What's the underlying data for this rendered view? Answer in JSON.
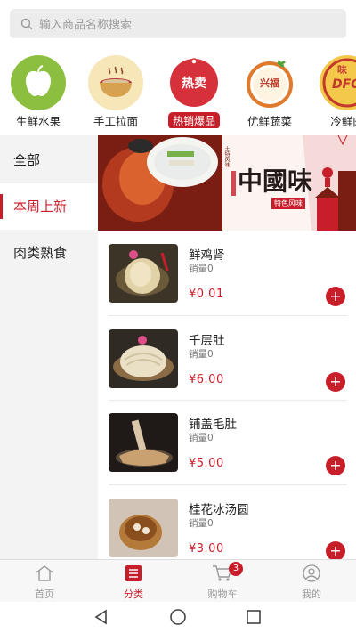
{
  "search": {
    "placeholder": "输入商品名称搜索"
  },
  "categories": [
    {
      "label": "生鲜水果",
      "icon": "apple-icon"
    },
    {
      "label": "手工拉面",
      "icon": "noodle-bowl-icon"
    },
    {
      "label": "热销爆品",
      "icon": "hot-sale-icon",
      "badge_text": "热卖"
    },
    {
      "label": "优鲜蔬菜",
      "icon": "vegetable-logo-icon",
      "logo_text": "兴福"
    },
    {
      "label": "冷鲜肉",
      "icon": "dfc-logo-icon",
      "logo_text": "DFC",
      "logo_small": "味"
    }
  ],
  "sidebar": {
    "items": [
      {
        "label": "全部"
      },
      {
        "label": "本周上新"
      },
      {
        "label": "肉类熟食"
      }
    ]
  },
  "banner": {
    "title": "中國味",
    "subtitle": "特色风味",
    "seal": "土特风味"
  },
  "products": [
    {
      "name": "鲜鸡肾",
      "sales": "销量0",
      "price": "¥0.01"
    },
    {
      "name": "千层肚",
      "sales": "销量0",
      "price": "¥6.00"
    },
    {
      "name": "铺盖毛肚",
      "sales": "销量0",
      "price": "¥5.00"
    },
    {
      "name": "桂花冰汤圆",
      "sales": "销量0",
      "price": "¥3.00"
    }
  ],
  "tabbar": {
    "items": [
      {
        "label": "首页",
        "icon": "home-icon"
      },
      {
        "label": "分类",
        "icon": "category-icon"
      },
      {
        "label": "购物车",
        "icon": "cart-icon"
      },
      {
        "label": "我的",
        "icon": "user-icon"
      }
    ],
    "cart_badge": "3"
  },
  "colors": {
    "accent": "#c81e2a",
    "background": "#ffffff",
    "sidebar": "#f3f3f3"
  }
}
